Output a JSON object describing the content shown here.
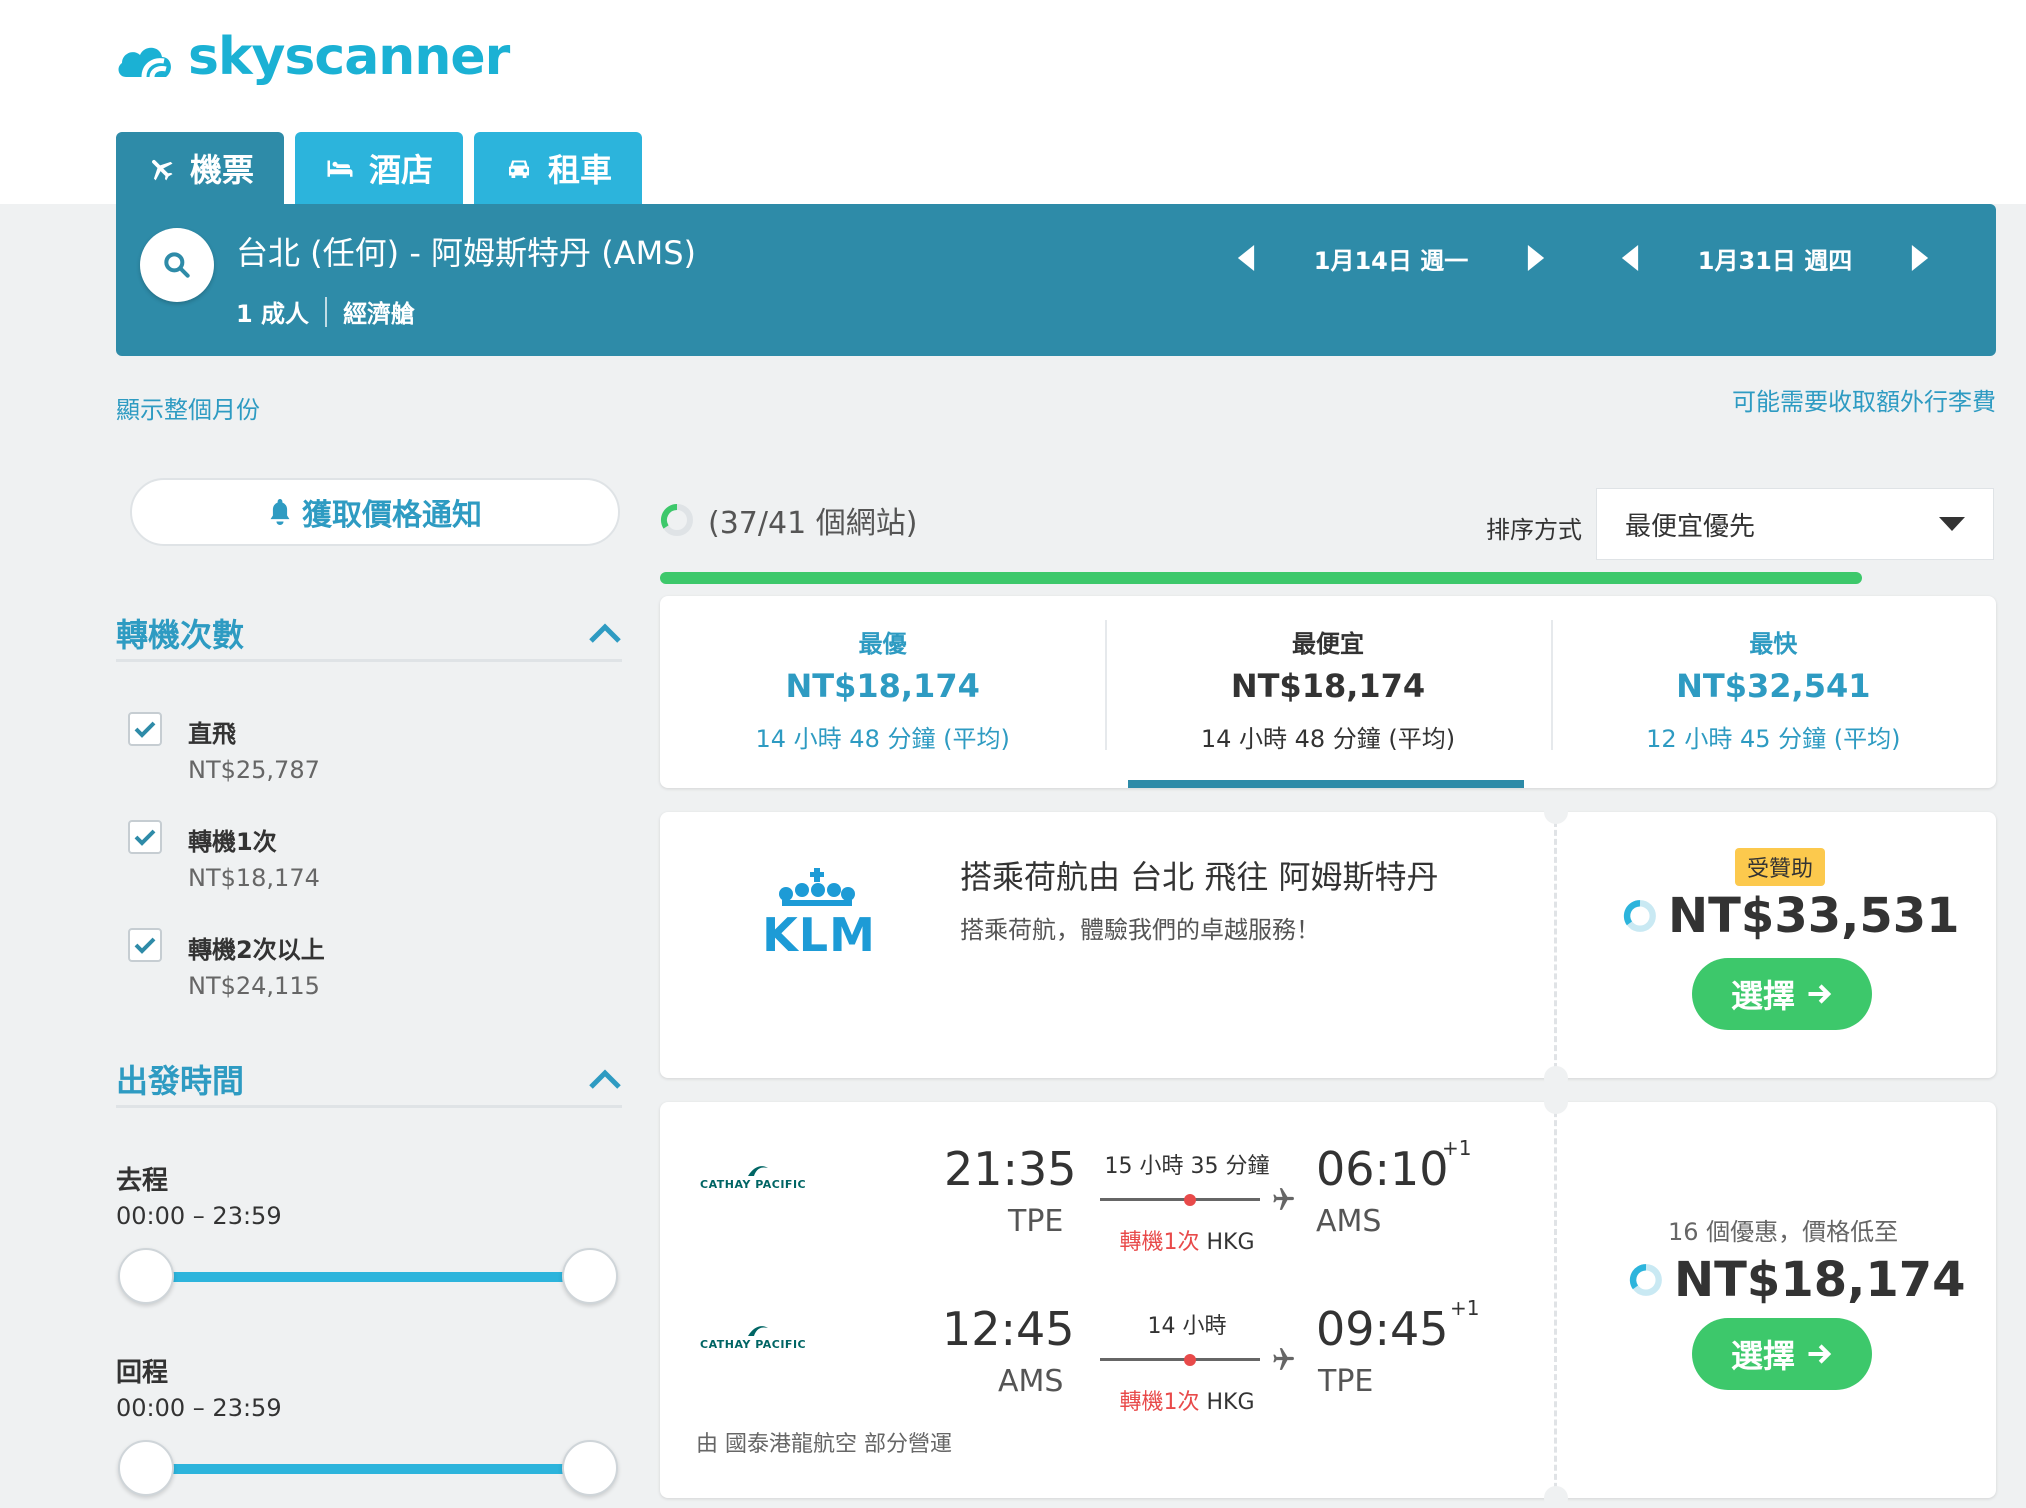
{
  "brand": {
    "name": "skyscanner",
    "color": "#1bb1d4"
  },
  "nav": {
    "tabs": [
      {
        "label": "機票",
        "icon": "plane-icon",
        "active": true
      },
      {
        "label": "酒店",
        "icon": "bed-icon",
        "active": false
      },
      {
        "label": "租車",
        "icon": "car-icon",
        "active": false
      }
    ]
  },
  "search": {
    "route": "台北 (任何) - 阿姆斯特丹 (AMS)",
    "passengers": "1 成人",
    "cabin": "經濟艙",
    "depart_date": "1月14日 週一",
    "return_date": "1月31日 週四"
  },
  "links": {
    "show_month": "顯示整個月份",
    "baggage_fee": "可能需要收取額外行李費"
  },
  "sidebar": {
    "price_alert": "獲取價格通知",
    "stops_title": "轉機次數",
    "stops": [
      {
        "label": "直飛",
        "price": "NT$25,787",
        "checked": true
      },
      {
        "label": "轉機1次",
        "price": "NT$18,174",
        "checked": true
      },
      {
        "label": "轉機2次以上",
        "price": "NT$24,115",
        "checked": true
      }
    ],
    "time_title": "出發時間",
    "outbound_label": "去程",
    "outbound_range": "00:00 – 23:59",
    "return_label": "回程",
    "return_range": "00:00 – 23:59"
  },
  "results": {
    "progress": "(37/41 個網站)",
    "progress_fraction": 0.9,
    "sort_label": "排序方式",
    "sort_value": "最便宜優先"
  },
  "summary": [
    {
      "label": "最優",
      "price": "NT$18,174",
      "duration": "14 小時 48 分鐘 (平均)",
      "active": false
    },
    {
      "label": "最便宜",
      "price": "NT$18,174",
      "duration": "14 小時 48 分鐘 (平均)",
      "active": true
    },
    {
      "label": "最快",
      "price": "NT$32,541",
      "duration": "12 小時 45 分鐘 (平均)",
      "active": false
    }
  ],
  "ad": {
    "airline": "KLM",
    "title": "搭乘荷航由 台北 飛往 阿姆斯特丹",
    "subtitle": "搭乘荷航，體驗我們的卓越服務！",
    "badge": "受贊助",
    "price": "NT$33,531",
    "select": "選擇"
  },
  "itinerary": {
    "airline": "CATHAY PACIFIC",
    "outbound": {
      "depart_time": "21:35",
      "depart_code": "TPE",
      "duration": "15 小時 35 分鐘",
      "stops": "轉機1次",
      "hub": "HKG",
      "arrive_time": "06:10",
      "arrive_code": "AMS",
      "day_offset": "+1"
    },
    "inbound": {
      "depart_time": "12:45",
      "depart_code": "AMS",
      "duration": "14 小時",
      "stops": "轉機1次",
      "hub": "HKG",
      "arrive_time": "09:45",
      "arrive_code": "TPE",
      "day_offset": "+1"
    },
    "operated_by": "由 國泰港龍航空 部分營運",
    "deals": "16 個優惠，價格低至",
    "price": "NT$18,174",
    "select": "選擇"
  },
  "colors": {
    "header_bg": "#2e8ba8",
    "tab_bg": "#2cb4dc",
    "link": "#2e9bc2",
    "cta": "#3dc86b",
    "stop_red": "#e84a4a",
    "sponsored": "#fcc94d"
  }
}
